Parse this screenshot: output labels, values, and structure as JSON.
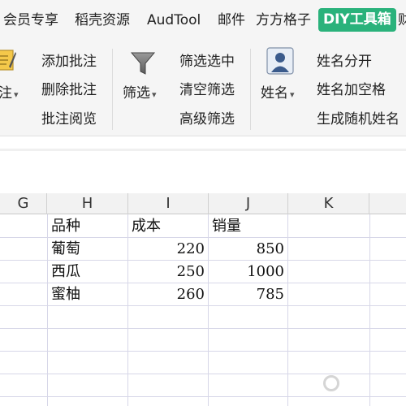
{
  "tabs": [
    {
      "label": "会员专享",
      "active": false
    },
    {
      "label": "稻壳资源",
      "active": false
    },
    {
      "label": "AudTool",
      "active": false
    },
    {
      "label": "邮件",
      "active": false
    },
    {
      "label": "方方格子",
      "active": false
    },
    {
      "label": "DIY工具箱",
      "active": true
    },
    {
      "label": "财",
      "active": false
    }
  ],
  "colors": {
    "active_tab_bg": "#2ab27b",
    "ribbon_bg": "#f5f5f5",
    "grid_line": "#d7d7e8"
  },
  "ribbon": {
    "comment_group": {
      "dropdown_label": "注",
      "items": [
        "添加批注",
        "删除批注",
        "批注阅览"
      ],
      "icon": "note-icon"
    },
    "filter_group": {
      "dropdown_label": "筛选",
      "items": [
        "筛选选中",
        "清空筛选",
        "高级筛选"
      ],
      "icon": "funnel-icon"
    },
    "name_group": {
      "dropdown_label": "姓名",
      "items": [
        "姓名分开",
        "姓名加空格",
        "生成随机姓名"
      ],
      "icon": "person-icon"
    }
  },
  "sheet": {
    "columns": [
      "G",
      "H",
      "I",
      "J",
      "K"
    ],
    "headers": [
      "品种",
      "成本",
      "销量"
    ],
    "rows": [
      {
        "variety": "葡萄",
        "cost": "220",
        "sales": "850"
      },
      {
        "variety": "西瓜",
        "cost": "250",
        "sales": "1000"
      },
      {
        "variety": "蜜柚",
        "cost": "260",
        "sales": "785"
      }
    ]
  }
}
